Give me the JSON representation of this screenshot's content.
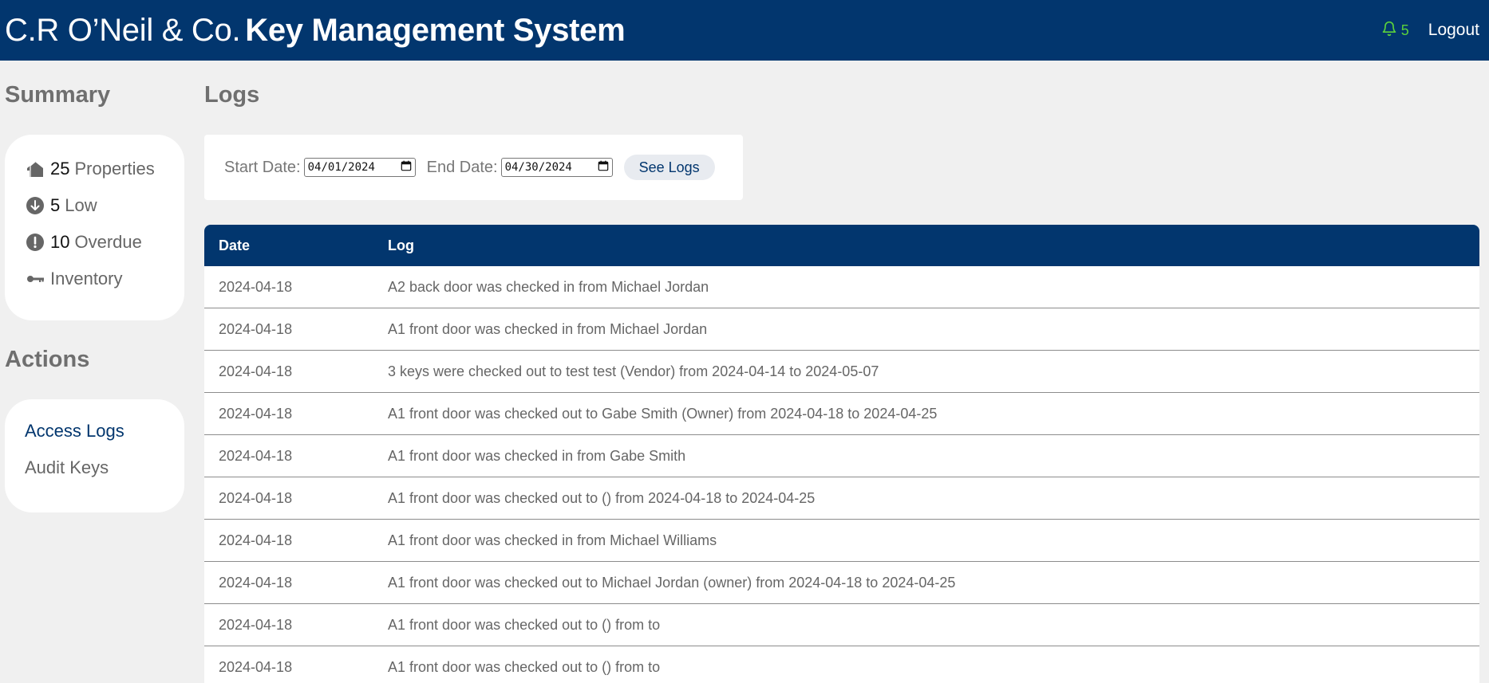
{
  "header": {
    "company": "C.R O’Neil & Co.",
    "system": "Key Management System",
    "notification_count": "5",
    "logout_label": "Logout"
  },
  "summary": {
    "title": "Summary",
    "items": [
      {
        "icon": "house-icon",
        "count": "25",
        "label": "Properties"
      },
      {
        "icon": "arrow-down-circle-icon",
        "count": "5",
        "label": "Low"
      },
      {
        "icon": "exclamation-circle-icon",
        "count": "10",
        "label": "Overdue"
      },
      {
        "icon": "key-icon",
        "count": "",
        "label": "Inventory"
      }
    ]
  },
  "actions": {
    "title": "Actions",
    "items": [
      {
        "label": "Access Logs",
        "active": true
      },
      {
        "label": "Audit Keys",
        "active": false
      }
    ]
  },
  "logs": {
    "title": "Logs",
    "start_label": "Start Date:",
    "start_value": "04/01/2024",
    "end_label": "End Date:",
    "end_value": "04/30/2024",
    "button_label": "See Logs",
    "columns": [
      "Date",
      "Log"
    ],
    "rows": [
      {
        "date": "2024-04-18",
        "log": "A2 back door was checked in from Michael Jordan"
      },
      {
        "date": "2024-04-18",
        "log": "A1 front door was checked in from Michael Jordan"
      },
      {
        "date": "2024-04-18",
        "log": "3 keys were checked out to test test (Vendor) from 2024-04-14 to 2024-05-07"
      },
      {
        "date": "2024-04-18",
        "log": "A1 front door was checked out to Gabe Smith (Owner) from 2024-04-18 to 2024-04-25"
      },
      {
        "date": "2024-04-18",
        "log": "A1 front door was checked in from Gabe Smith"
      },
      {
        "date": "2024-04-18",
        "log": "A1 front door was checked out to () from 2024-04-18 to 2024-04-25"
      },
      {
        "date": "2024-04-18",
        "log": "A1 front door was checked in from Michael Williams"
      },
      {
        "date": "2024-04-18",
        "log": "A1 front door was checked out to Michael Jordan (owner) from 2024-04-18 to 2024-04-25"
      },
      {
        "date": "2024-04-18",
        "log": "A1 front door was checked out to () from to"
      },
      {
        "date": "2024-04-18",
        "log": "A1 front door was checked out to () from to"
      }
    ]
  },
  "colors": {
    "header_bg": "#02366e",
    "page_bg": "#f0f0f0",
    "notification": "#5bd13c",
    "link_active": "#02366e"
  }
}
